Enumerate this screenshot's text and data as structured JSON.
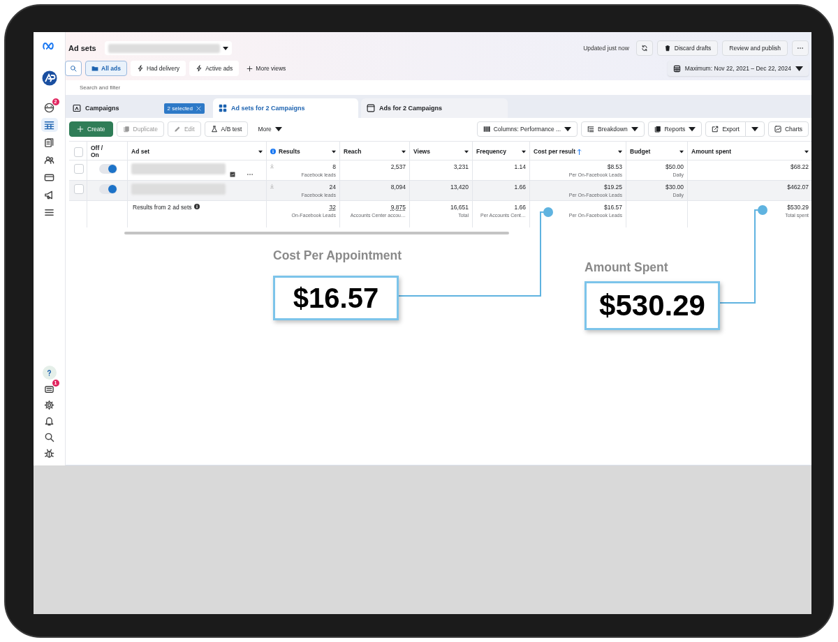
{
  "sidebar": {
    "items": [
      {
        "kind": "avatar",
        "selected": false
      },
      {
        "kind": "face",
        "selected": false,
        "badge": "2"
      },
      {
        "kind": "table",
        "selected": true
      },
      {
        "kind": "pages",
        "selected": false
      },
      {
        "kind": "people",
        "selected": false
      },
      {
        "kind": "card",
        "selected": false
      },
      {
        "kind": "megaphone",
        "selected": false
      },
      {
        "kind": "menu",
        "selected": false
      }
    ],
    "bottom_items": [
      {
        "kind": "help",
        "selected": true
      },
      {
        "kind": "news",
        "selected": false,
        "badge": "1"
      },
      {
        "kind": "gear",
        "selected": false
      },
      {
        "kind": "bell",
        "selected": false
      },
      {
        "kind": "search",
        "selected": false
      },
      {
        "kind": "bug",
        "selected": false
      }
    ]
  },
  "header": {
    "title": "Ad sets",
    "status": "Updated just now",
    "buttons": [
      "Discard drafts",
      "Review and publish"
    ],
    "date_range": "Maximum: Nov 22, 2021 – Dec 22, 2024"
  },
  "views": [
    {
      "label": "All ads",
      "selected": true
    },
    {
      "label": "Had delivery",
      "selected": false
    },
    {
      "label": "Active ads",
      "selected": false
    }
  ],
  "more_views": "More views",
  "search": {
    "placeholder": "Search and filter"
  },
  "level_tabs": [
    {
      "label": "Campaigns",
      "selected": false,
      "badge": "2 selected"
    },
    {
      "label": "Ad sets for 2 Campaigns",
      "selected": true
    },
    {
      "label": "Ads for 2 Campaigns",
      "selected": false
    }
  ],
  "toolbar": {
    "left": [
      {
        "label": "Create",
        "kind": "primary",
        "disabled": false
      },
      {
        "label": "Duplicate",
        "kind": "copy",
        "disabled": true
      },
      {
        "label": "Edit",
        "kind": "edit",
        "disabled": true
      },
      {
        "label": "A/B test",
        "kind": "flask",
        "disabled": false
      }
    ],
    "more": "More",
    "right": [
      {
        "label": "Columns: Performance ...",
        "kind": "columns"
      },
      {
        "label": "Breakdown",
        "kind": "breakdown"
      },
      {
        "label": "Reports",
        "kind": "reports"
      },
      {
        "label": "Export",
        "kind": "export"
      },
      {
        "label": "Charts",
        "kind": "charts"
      }
    ]
  },
  "table": {
    "select_all": false,
    "columns": [
      {
        "label": "Off / On",
        "info": false,
        "sorted": false
      },
      {
        "label": "Ad set",
        "info": false,
        "sorted": false
      },
      {
        "label": "Results",
        "info": true,
        "sorted": false
      },
      {
        "label": "Reach",
        "info": false,
        "sorted": false
      },
      {
        "label": "Views",
        "info": false,
        "sorted": false
      },
      {
        "label": "Frequency",
        "info": false,
        "sorted": false
      },
      {
        "label": "Cost per result",
        "info": false,
        "sorted": true
      },
      {
        "label": "Budget",
        "info": false,
        "sorted": false
      },
      {
        "label": "Amount spent",
        "info": false,
        "sorted": false
      }
    ],
    "rows": [
      {
        "selected": false,
        "on": true,
        "highlighted": false,
        "show_actions": true,
        "cells": [
          {
            "value": "8",
            "sub": "Facebook leads"
          },
          {
            "value": "2,537"
          },
          {
            "value": "3,231"
          },
          {
            "value": "1.14"
          },
          {
            "value": "$8.53",
            "sub": "Per On-Facebook Leads"
          },
          {
            "value": "$50.00",
            "sub": "Daily"
          },
          {
            "value": "$68.22"
          }
        ]
      },
      {
        "selected": false,
        "on": true,
        "highlighted": true,
        "show_actions": false,
        "cells": [
          {
            "value": "24",
            "sub": "Facebook leads"
          },
          {
            "value": "8,094"
          },
          {
            "value": "13,420"
          },
          {
            "value": "1.66"
          },
          {
            "value": "$19.25",
            "sub": "Per On-Facebook Leads"
          },
          {
            "value": "$30.00",
            "sub": "Daily"
          },
          {
            "value": "$462.07"
          }
        ]
      }
    ],
    "totals": {
      "label": "Results from 2 ad sets",
      "cells": [
        {
          "value": "32",
          "sub": "On-Facebook Leads"
        },
        {
          "value": "9,875",
          "sub": "Accounts Center accou…"
        },
        {
          "value": "16,651",
          "sub": "Total"
        },
        {
          "value": "1.66",
          "sub": "Per Accounts Cent…"
        },
        {
          "value": "$16.57",
          "sub": "Per On-Facebook Leads"
        },
        null,
        {
          "value": "$530.29",
          "sub": "Total spent"
        }
      ]
    }
  },
  "callouts": [
    {
      "label": "Cost Per Appointment",
      "value": "$16.57"
    },
    {
      "label": "Amount Spent",
      "value": "$530.29"
    }
  ]
}
